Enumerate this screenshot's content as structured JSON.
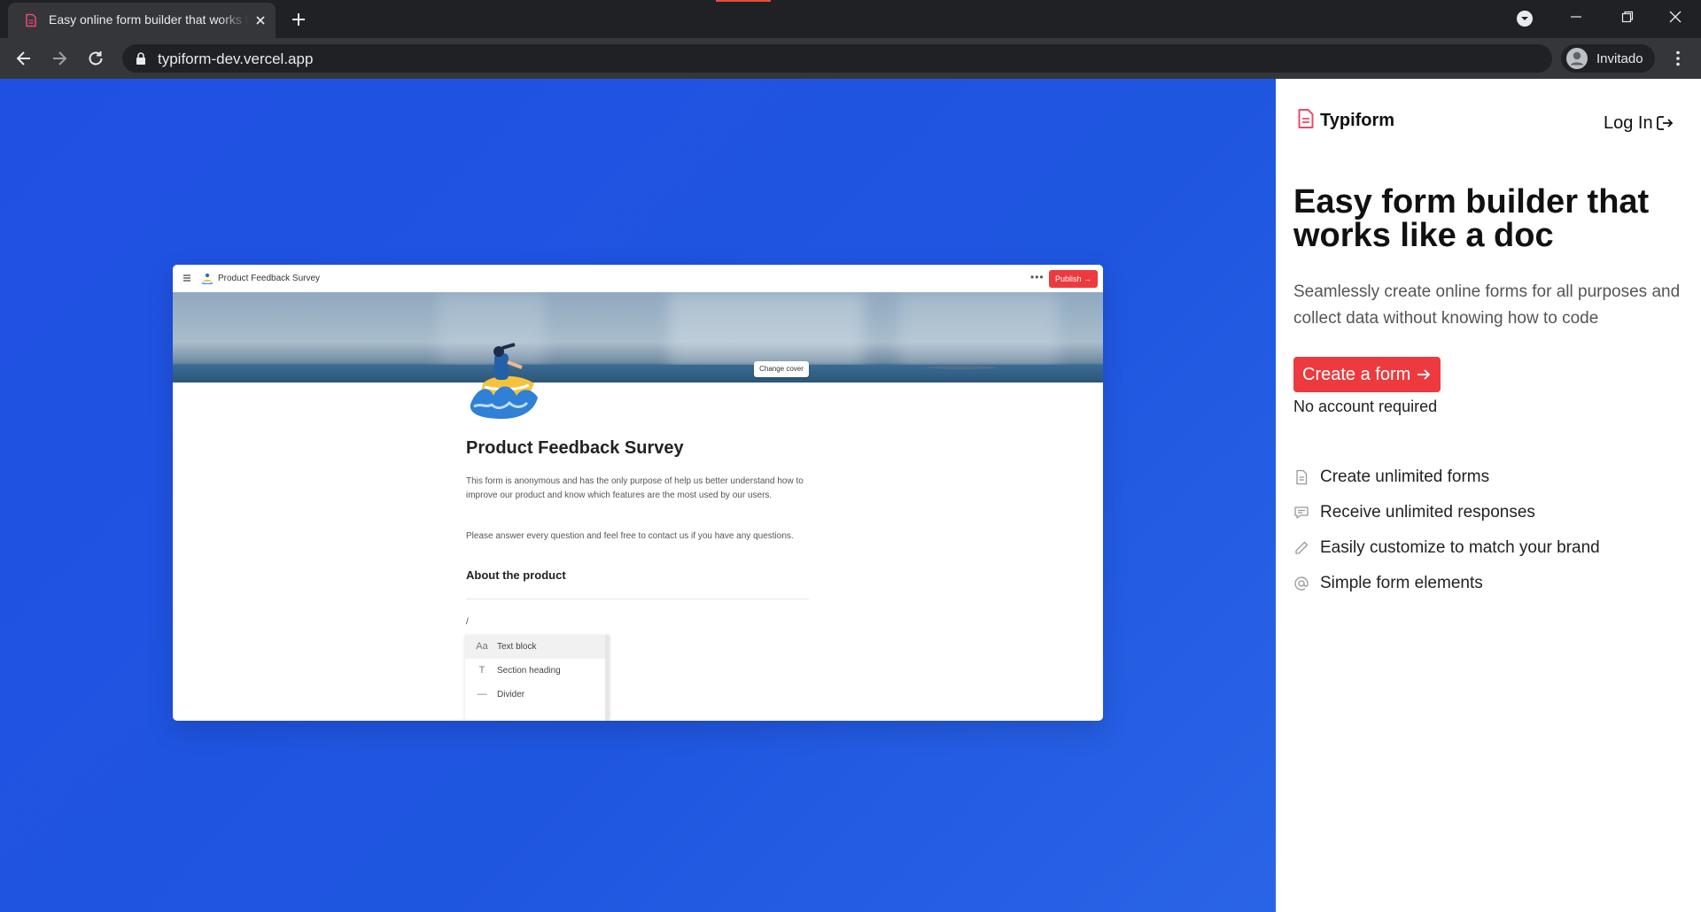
{
  "browser": {
    "tab_title": "Easy online form builder that works like a doc",
    "url": "typiform-dev.vercel.app",
    "profile_name": "Invitado"
  },
  "preview": {
    "doc_title": "Product Feedback Survey",
    "publish_label": "Publish →",
    "change_cover_label": "Change cover",
    "heading": "Product Feedback Survey",
    "paragraph_1": "This form is anonymous and has the only purpose of help us better understand how to improve our product and know which features are the most used by our users.",
    "paragraph_2": "Please answer every question and feel free to contact us if you have any questions.",
    "section_heading": "About the product",
    "slash": "/",
    "block_menu": [
      {
        "icon": "Aa",
        "label": "Text block"
      },
      {
        "icon": "T",
        "label": "Section heading"
      },
      {
        "icon": "—",
        "label": "Divider"
      }
    ]
  },
  "panel": {
    "brand": "Typiform",
    "login_label": "Log In",
    "headline": "Easy form builder that works like a doc",
    "subtitle": "Seamlessly create online forms for all purposes and collect data without knowing how to code",
    "cta_label": "Create a form",
    "no_account": "No account required",
    "features": [
      {
        "icon": "document-icon",
        "label": "Create unlimited forms"
      },
      {
        "icon": "message-icon",
        "label": "Receive unlimited responses"
      },
      {
        "icon": "pencil-icon",
        "label": "Easily customize to match your brand"
      },
      {
        "icon": "at-icon",
        "label": "Simple form elements"
      }
    ]
  },
  "colors": {
    "brand_red": "#ec3a3f",
    "hero_blue": "#2050e2",
    "chrome_dark": "#202124",
    "chrome_toolbar": "#35363a"
  }
}
